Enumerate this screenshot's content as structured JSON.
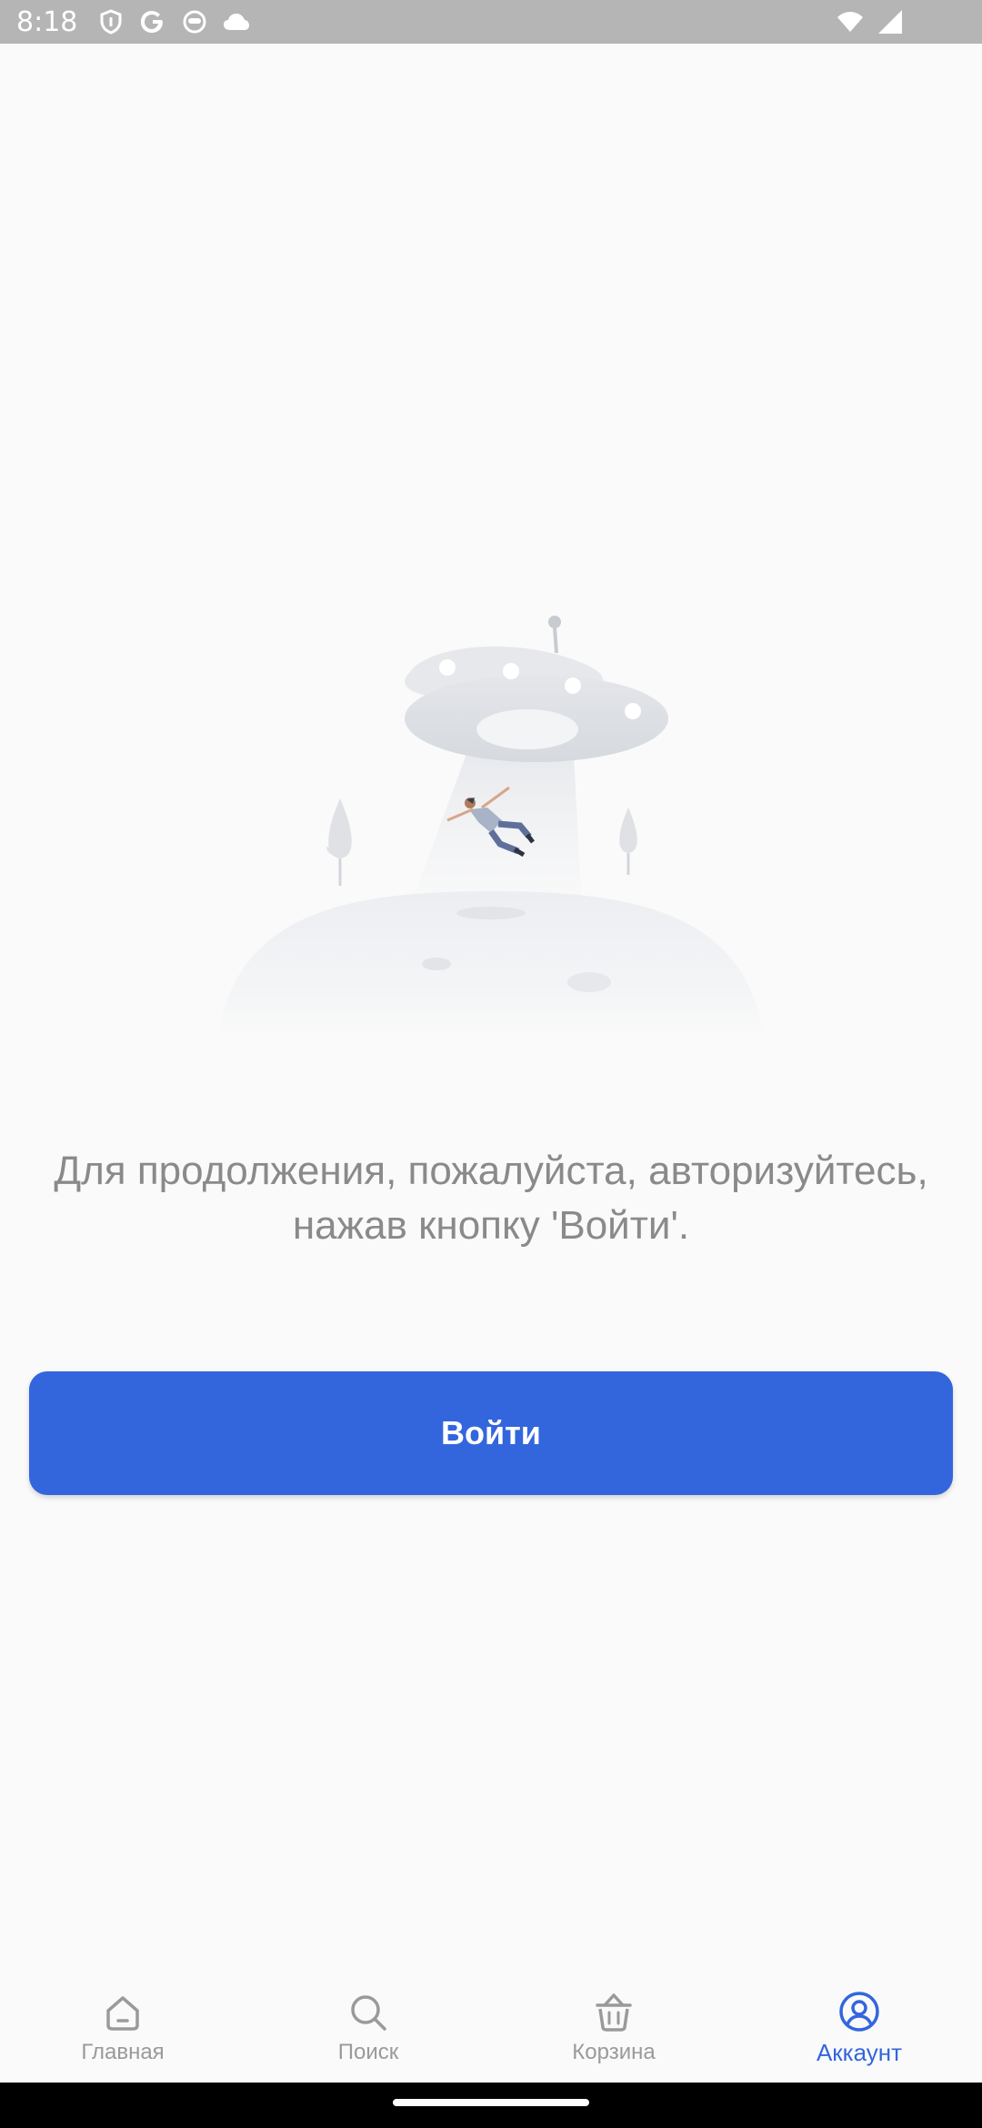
{
  "status_bar": {
    "time": "8:18",
    "left_icons": [
      "shield-icon",
      "google-icon",
      "robot-icon",
      "cloud-icon"
    ],
    "right_icons": [
      "wifi-icon",
      "signal-icon"
    ]
  },
  "main": {
    "message": "Для продолжения, пожалуйста, авторизуйтесь, нажав кнопку 'Войти'.",
    "login_button_label": "Войти"
  },
  "bottom_nav": {
    "items": [
      {
        "label": "Главная",
        "icon": "home-icon",
        "active": false
      },
      {
        "label": "Поиск",
        "icon": "search-icon",
        "active": false
      },
      {
        "label": "Корзина",
        "icon": "basket-icon",
        "active": false
      },
      {
        "label": "Аккаунт",
        "icon": "account-icon",
        "active": true
      }
    ]
  },
  "colors": {
    "accent": "#3366dd",
    "inactive": "#9a9a9a",
    "background": "#fafafa",
    "status_bar": "#b5b5b5"
  }
}
